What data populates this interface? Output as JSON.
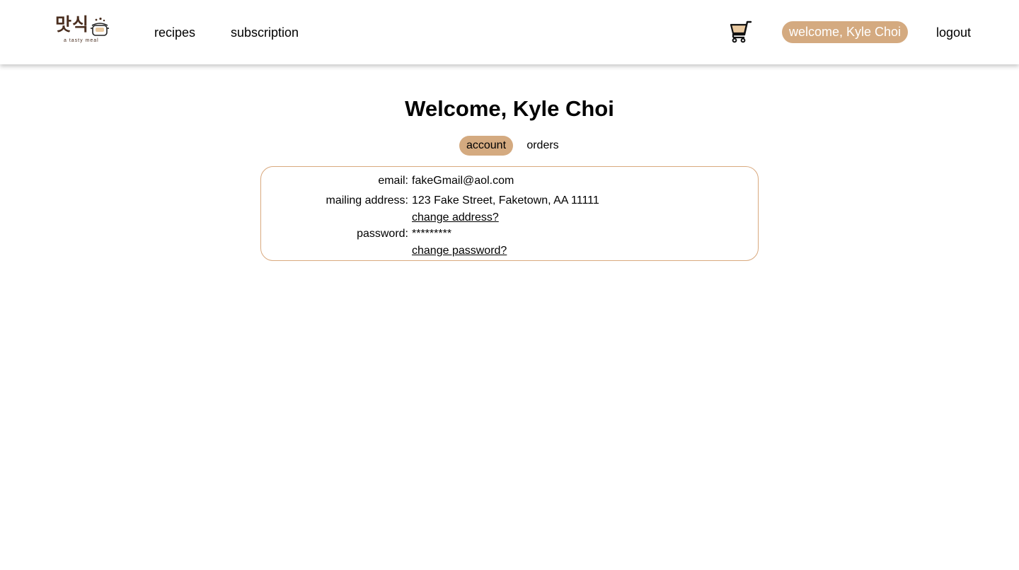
{
  "header": {
    "logo": {
      "main_text": "맛식",
      "tagline": "a tasty meal",
      "icon": "cooking-pot-icon"
    },
    "nav": [
      {
        "label": "recipes"
      },
      {
        "label": "subscription"
      }
    ],
    "cart_icon": "shopping-cart-icon",
    "user_pill": "welcome, Kyle Choi",
    "logout_label": "logout"
  },
  "main": {
    "title": "Welcome, Kyle Choi",
    "tabs": [
      {
        "label": "account",
        "active": true
      },
      {
        "label": "orders",
        "active": false
      }
    ],
    "account": {
      "email_label": "email:",
      "email_value": "fakeGmail@aol.com",
      "address_label": "mailing address:",
      "address_value": "123 Fake Street, Faketown, AA 11111",
      "change_address_link": "change address?",
      "password_label": "password:",
      "password_value": "*********",
      "change_password_link": "change password?"
    }
  },
  "colors": {
    "accent": "#d4aa80",
    "box_border": "#d9a97e",
    "logo_brown": "#4a2e1f"
  }
}
